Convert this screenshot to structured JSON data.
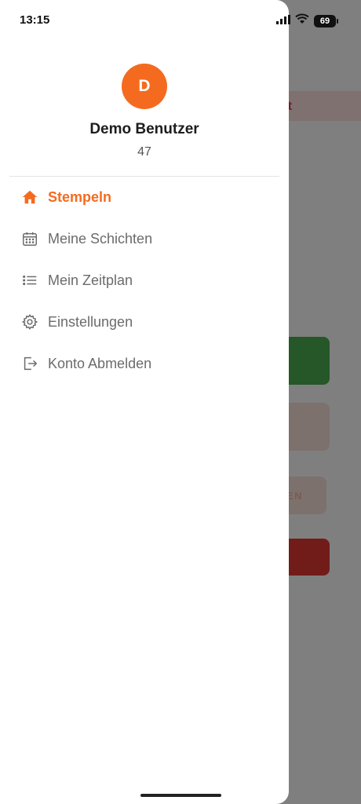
{
  "status_bar": {
    "time": "13:15",
    "battery": "69"
  },
  "background_app": {
    "banner_fragment": "t",
    "outline_button_fragment": "EN"
  },
  "drawer": {
    "avatar_initial": "D",
    "user_name": "Demo Benutzer",
    "user_id": "47",
    "menu": [
      {
        "label": "Stempeln",
        "icon": "home-icon",
        "active": true
      },
      {
        "label": "Meine Schichten",
        "icon": "calendar-icon",
        "active": false
      },
      {
        "label": "Mein Zeitplan",
        "icon": "list-icon",
        "active": false
      },
      {
        "label": "Einstellungen",
        "icon": "gear-icon",
        "active": false
      },
      {
        "label": "Konto Abmelden",
        "icon": "logout-icon",
        "active": false
      }
    ]
  },
  "colors": {
    "accent": "#f46b1f",
    "inactive_text": "#6b6b6b",
    "scrim": "rgba(0,0,0,0.5)"
  }
}
